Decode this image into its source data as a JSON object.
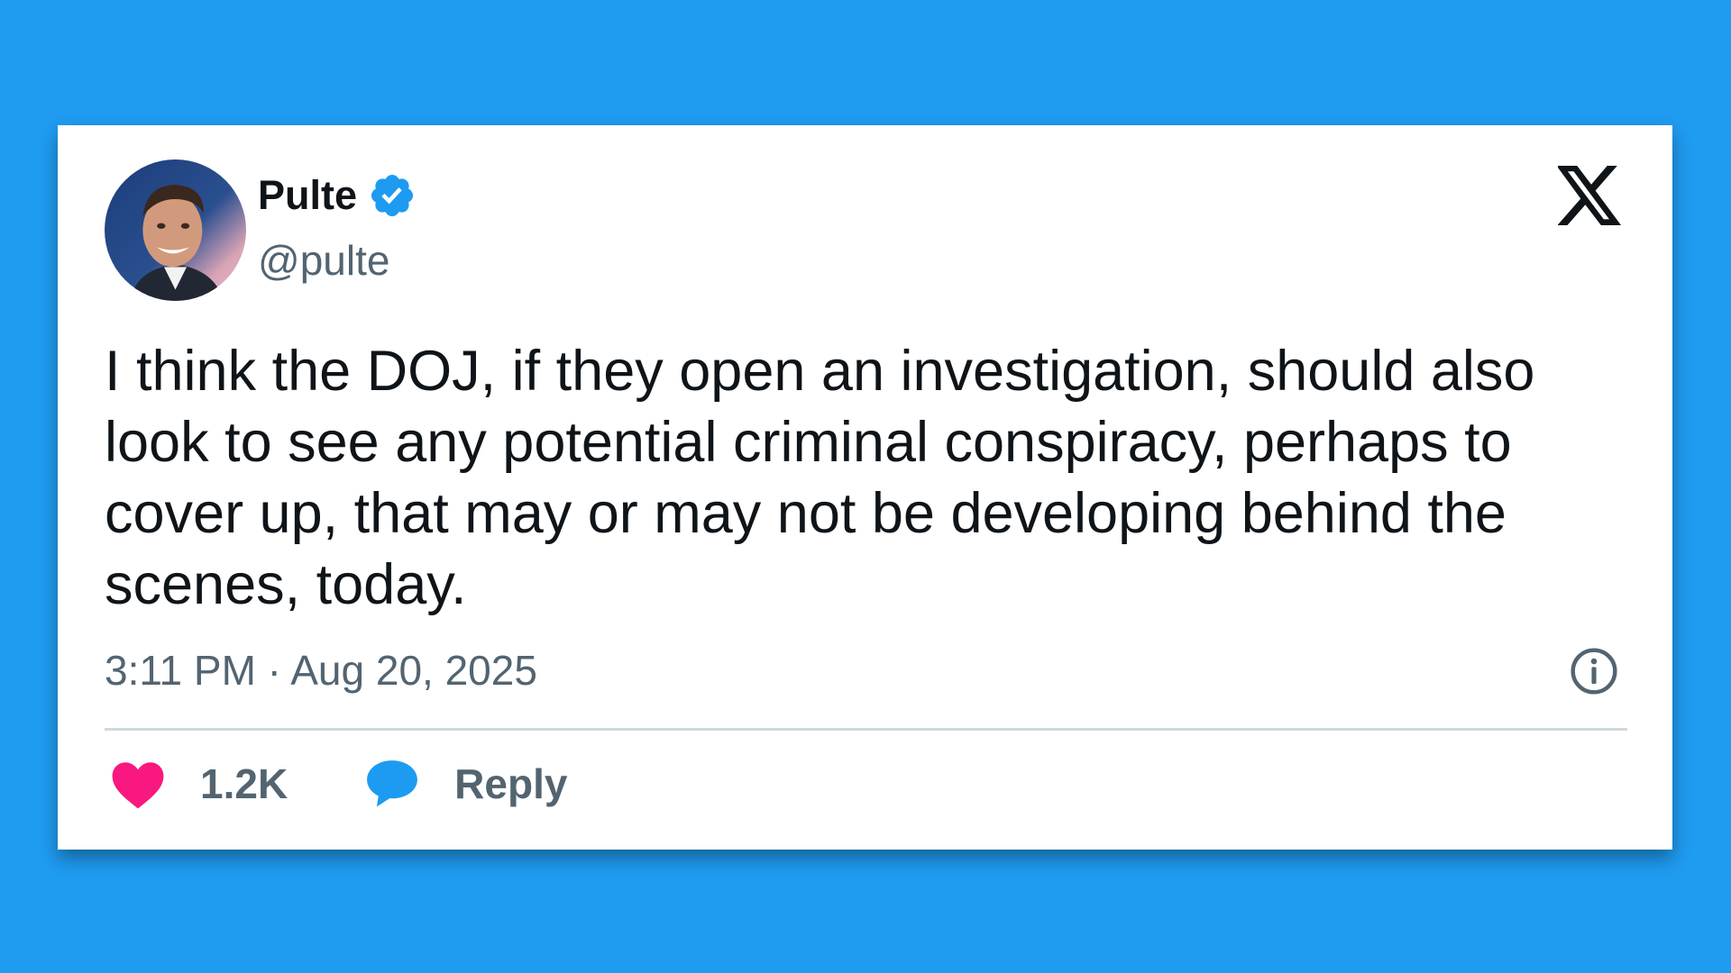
{
  "colors": {
    "background": "#1f9bf0",
    "card": "#ffffff",
    "verified_badge": "#1d9bf0",
    "like_heart": "#f91880",
    "reply_bubble": "#1d9bf0",
    "secondary_text": "#536471"
  },
  "author": {
    "display_name": "Pulte",
    "handle": "@pulte",
    "verified": true,
    "avatar_icon": "profile-photo"
  },
  "platform": {
    "logo_icon": "x-logo"
  },
  "tweet": {
    "text": "I think the DOJ, if they open an investigation, should also look to see any potential criminal conspiracy, perhaps to cover up, that may or may not be developing behind the scenes, today.",
    "timestamp": "3:11 PM · Aug 20, 2025"
  },
  "actions": {
    "like": {
      "icon": "heart-icon",
      "label": "1.2K"
    },
    "reply": {
      "icon": "speech-bubble-icon",
      "label": "Reply"
    },
    "info": {
      "icon": "info-icon"
    }
  }
}
